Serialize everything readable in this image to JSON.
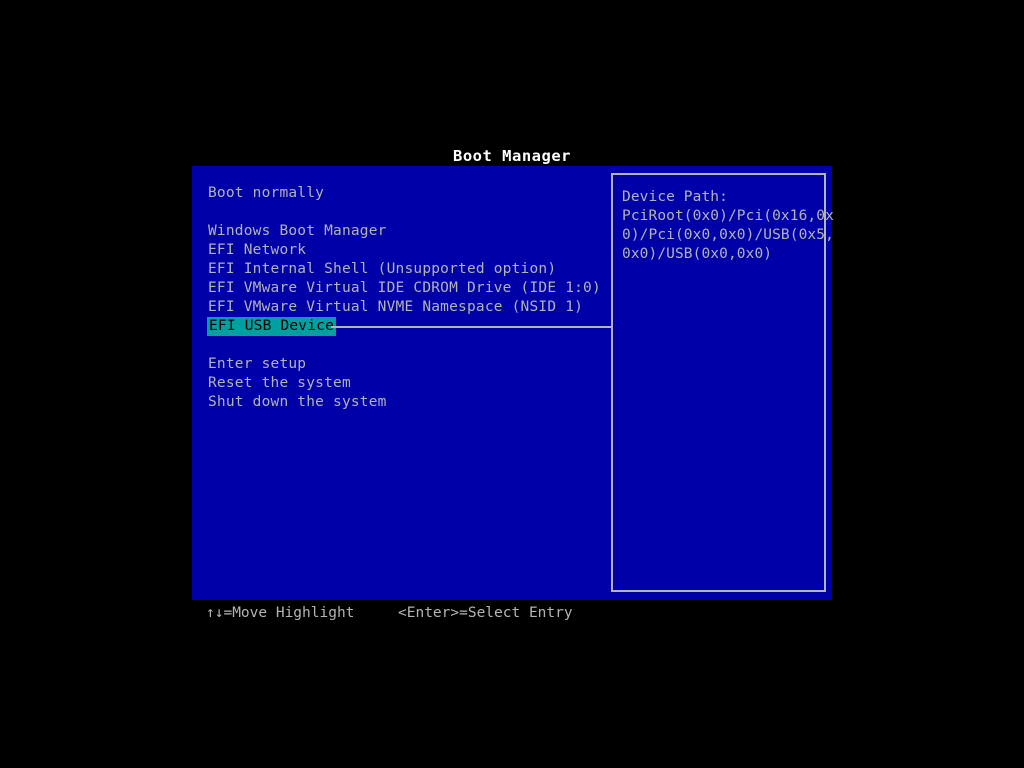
{
  "title": "Boot Manager",
  "colors": {
    "background": "#000000",
    "window": "#0000a8",
    "text": "#b4b4b4",
    "title_text": "#ffffff",
    "highlight_bg": "#00a0a0",
    "highlight_text": "#000000",
    "border": "#b4b4b4"
  },
  "menu": {
    "items": [
      {
        "label": "Boot normally",
        "selected": false,
        "spacer": false
      },
      {
        "label": "",
        "selected": false,
        "spacer": true
      },
      {
        "label": "Windows Boot Manager",
        "selected": false,
        "spacer": false
      },
      {
        "label": "EFI Network",
        "selected": false,
        "spacer": false
      },
      {
        "label": "EFI Internal Shell (Unsupported option)",
        "selected": false,
        "spacer": false
      },
      {
        "label": "EFI VMware Virtual IDE CDROM Drive (IDE 1:0)",
        "selected": false,
        "spacer": false
      },
      {
        "label": "EFI VMware Virtual NVME Namespace (NSID 1)",
        "selected": false,
        "spacer": false
      },
      {
        "label": "EFI USB Device",
        "selected": true,
        "spacer": false
      },
      {
        "label": "",
        "selected": false,
        "spacer": true
      },
      {
        "label": "Enter setup",
        "selected": false,
        "spacer": false
      },
      {
        "label": "Reset the system",
        "selected": false,
        "spacer": false
      },
      {
        "label": "Shut down the system",
        "selected": false,
        "spacer": false
      }
    ]
  },
  "info_panel": {
    "heading": "Device Path:",
    "lines": [
      "Device Path:",
      "PciRoot(0x0)/Pci(0x16,0x",
      "0)/Pci(0x0,0x0)/USB(0x5,",
      "0x0)/USB(0x0,0x0)"
    ],
    "device_path": "PciRoot(0x0)/Pci(0x16,0x0)/Pci(0x0,0x0)/USB(0x5,0x0)/USB(0x0,0x0)"
  },
  "footer": {
    "move_hint": "↑↓=Move Highlight",
    "select_hint": "<Enter>=Select Entry"
  }
}
